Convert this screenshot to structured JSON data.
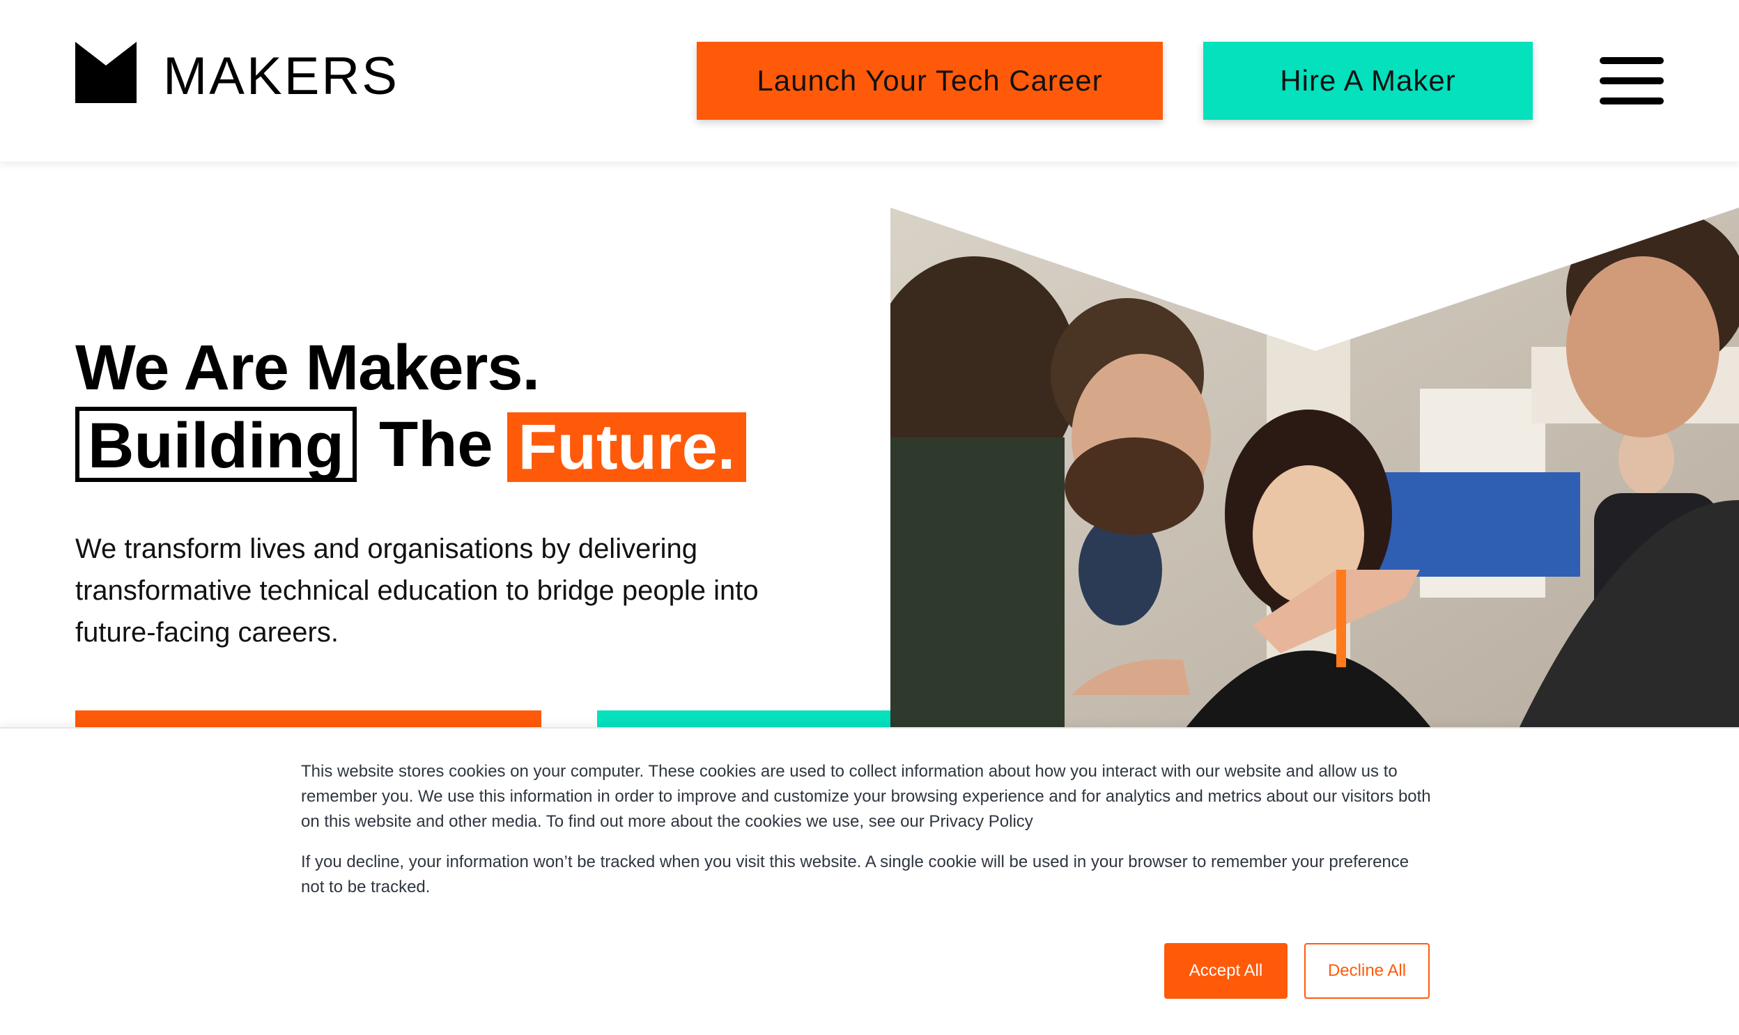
{
  "header": {
    "logo_text": "MAKERS",
    "launch_button": "Launch Your Tech Career",
    "hire_button": "Hire A Maker",
    "menu_icon": "hamburger-menu-icon"
  },
  "hero": {
    "title_line1": "We Are Makers.",
    "word_building": "Building",
    "word_the": "The",
    "word_future": "Future.",
    "description": "We transform lives and organisations by delivering transformative technical education to bridge people into future-facing careers.",
    "photo_icon": "team-photo"
  },
  "cookie_banner": {
    "text1": "This website stores cookies on your computer. These cookies are used to collect information about how you interact with our website and allow us to remember you. We use this information in order to improve and customize your browsing experience and for analytics and metrics about our visitors both on this website and other media. To find out more about the cookies we use, see our Privacy Policy",
    "text2": "If you decline, your information won’t be tracked when you visit this website. A single cookie will be used in your browser to remember your preference not to be tracked.",
    "accept_label": "Accept All",
    "decline_label": "Decline All"
  },
  "colors": {
    "brand_orange": "#ff5a0a",
    "brand_teal": "#05e0bd",
    "text_dark": "#2f3640"
  }
}
